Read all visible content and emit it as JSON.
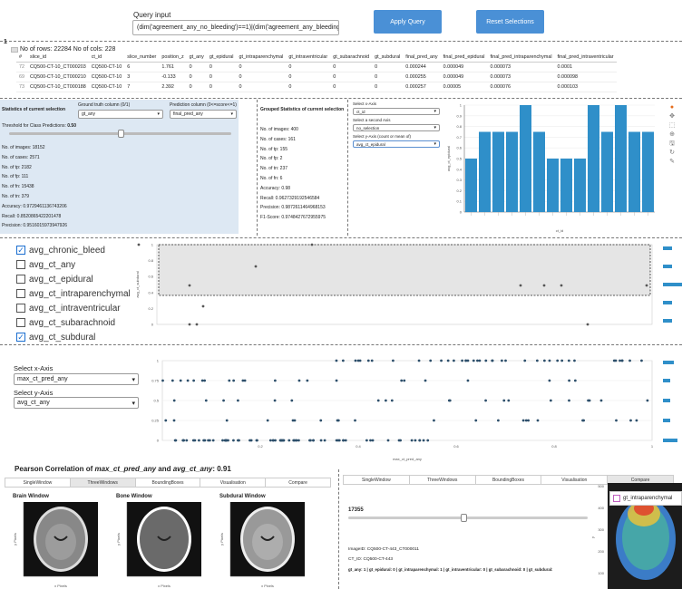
{
  "query": {
    "label": "Query input",
    "value": "(dim('agreement_any_no_bleeding')==1)|(dim('agreement_any_bleeding')==1)",
    "apply_label": "Apply Query",
    "reset_label": "Reset Selections"
  },
  "table": {
    "row_marker": "1",
    "summary": "No of rows: 22284 No of cols: 228",
    "columns": [
      "#",
      "slice_id",
      "ct_id",
      "slice_number",
      "position_z",
      "gt_any",
      "gt_epidural",
      "gt_intraparenchymal",
      "gt_intraventricular",
      "gt_subarachnoid",
      "gt_subdural",
      "final_pred_any",
      "final_pred_epidural",
      "final_pred_intraparenchymal",
      "final_pred_intraventricular"
    ],
    "rows": [
      [
        "72",
        "CQ500-CT-10_CT000203",
        "CQ500-CT-10",
        "6",
        "1.761",
        "0",
        "0",
        "0",
        "0",
        "0",
        "0",
        "0.000244",
        "0.000049",
        "0.000073",
        "0.0001"
      ],
      [
        "69",
        "CQ500-CT-10_CT000210",
        "CQ500-CT-10",
        "3",
        "-0.133",
        "0",
        "0",
        "0",
        "0",
        "0",
        "0",
        "0.000255",
        "0.000049",
        "0.000073",
        "0.000098"
      ],
      [
        "73",
        "CQ500-CT-10_CT000188",
        "CQ500-CT-10",
        "7",
        "2.392",
        "0",
        "0",
        "0",
        "0",
        "0",
        "0",
        "0.000257",
        "0.00005",
        "0.000076",
        "0.000103"
      ]
    ]
  },
  "stats": {
    "title": "Statistics of current selection",
    "gt_label": "Ground truth column (0/1)",
    "gt_value": "gt_any",
    "pred_label": "Prediction column (0<=score<=1)",
    "pred_value": "final_pred_any",
    "threshold_label": "Threshold for Class Predictions:",
    "threshold_value": "0.50",
    "threshold": 0.5,
    "lines": [
      "No. of images: 18152",
      "No. of cases: 2571",
      "No. of tp: 2182",
      "No. of fp: 111",
      "No. of fn: 15438",
      "No. of tn: 379",
      "Accuracy: 0.9729461136743206",
      "Recall: 0.8520865422201478",
      "Precision: 0.9516015973947926"
    ]
  },
  "grouped": {
    "title": "Grouped Statistics of current selection",
    "lines": [
      "No. of images: 400",
      "No. of cases: 161",
      "No. of tp: 155",
      "No. of fp: 2",
      "No. of tn: 237",
      "No. of fn: 6",
      "Accuracy: 0.98",
      "Recall: 0.9627329192546584",
      "Precision: 0.9872611464968153",
      "F1-Score: 0.9748427672955975"
    ]
  },
  "axis_select": {
    "x_label": "Select x-Axis",
    "x_value": "ct_id",
    "second_label": "Select a second Axis",
    "second_value": "no_selection",
    "y_label": "Select y-Axis (count or mean of)",
    "y_value": "avg_ct_epidural"
  },
  "bar_chart": {
    "ylabel": "avg_ct_epidural",
    "xlabel": "ct_id",
    "yticks": [
      "0",
      "0.1",
      "0.2",
      "0.3",
      "0.4",
      "0.5",
      "0.6",
      "0.7",
      "0.8",
      "0.9",
      "1"
    ],
    "values": [
      0.5,
      0.75,
      0.75,
      0.75,
      1.0,
      0.75,
      0.5,
      0.5,
      0.5,
      1.0,
      0.75,
      1.0,
      0.75,
      0.75
    ],
    "color": "#2f8fc9"
  },
  "checkboxes": [
    {
      "label": "avg_chronic_bleed",
      "checked": true
    },
    {
      "label": "avg_ct_any",
      "checked": false
    },
    {
      "label": "avg_ct_epidural",
      "checked": false
    },
    {
      "label": "avg_ct_intraparenchymal",
      "checked": false
    },
    {
      "label": "avg_ct_intraventricular",
      "checked": false
    },
    {
      "label": "avg_ct_subarachnoid",
      "checked": false
    },
    {
      "label": "avg_ct_subdural",
      "checked": true
    }
  ],
  "scatter1": {
    "ylabel": "avg_ct_subdural",
    "yticks": [
      "0",
      "0.2",
      "0.4",
      "0.6",
      "0.8",
      "1"
    ]
  },
  "xy_select": {
    "x_label": "Select x-Axis",
    "x_value": "max_ct_pred_any",
    "y_label": "Select y-Axis",
    "y_value": "avg_ct_any"
  },
  "scatter2": {
    "xlabel": "max_ct_pred_any",
    "yticks": [
      "0",
      "0.25",
      "0.5",
      "0.75",
      "1"
    ],
    "xticks": [
      "0.2",
      "0.4",
      "0.6",
      "0.8",
      "1"
    ]
  },
  "correlation": {
    "prefix": "Pearson Correlation of ",
    "x": "max_ct_pred_any",
    "and": " and ",
    "y": "avg_ct_any",
    "value": ": 0.91"
  },
  "tabs_left": [
    "SingleWindow",
    "ThreeWindows",
    "BoundingBoxes",
    "Visualisation",
    "Compare"
  ],
  "tabs_left_active": 1,
  "windows": [
    {
      "title": "Brain Window",
      "xlabel": "x Pixels",
      "ylabel": "y Pixels"
    },
    {
      "title": "Bone Window",
      "xlabel": "x Pixels",
      "ylabel": "y Pixels"
    },
    {
      "title": "Subdural Window",
      "xlabel": "x Pixels",
      "ylabel": "y Pixels"
    }
  ],
  "tabs_right": [
    "SingleWindow",
    "ThreeWindows",
    "BoundingBoxes",
    "Visualisation",
    "Compare"
  ],
  "tabs_right_active": 4,
  "viewer": {
    "slider_value": "17355",
    "image_id": "ImageID: CQ500-CT-443_CT000011",
    "ct_id": "CT_ID: CQ500-CT-443",
    "labels": "gt_any: 1 | gt_epidural: 0 | gt_intraparenchymal: 1 | gt_intraventricular: 0 | gt_subarachnoid: 0 | gt_subdural:",
    "legend": "gt_intraparenchymal",
    "yticks": [
      "500",
      "400",
      "300",
      "200",
      "100"
    ],
    "ylabel": "y"
  }
}
